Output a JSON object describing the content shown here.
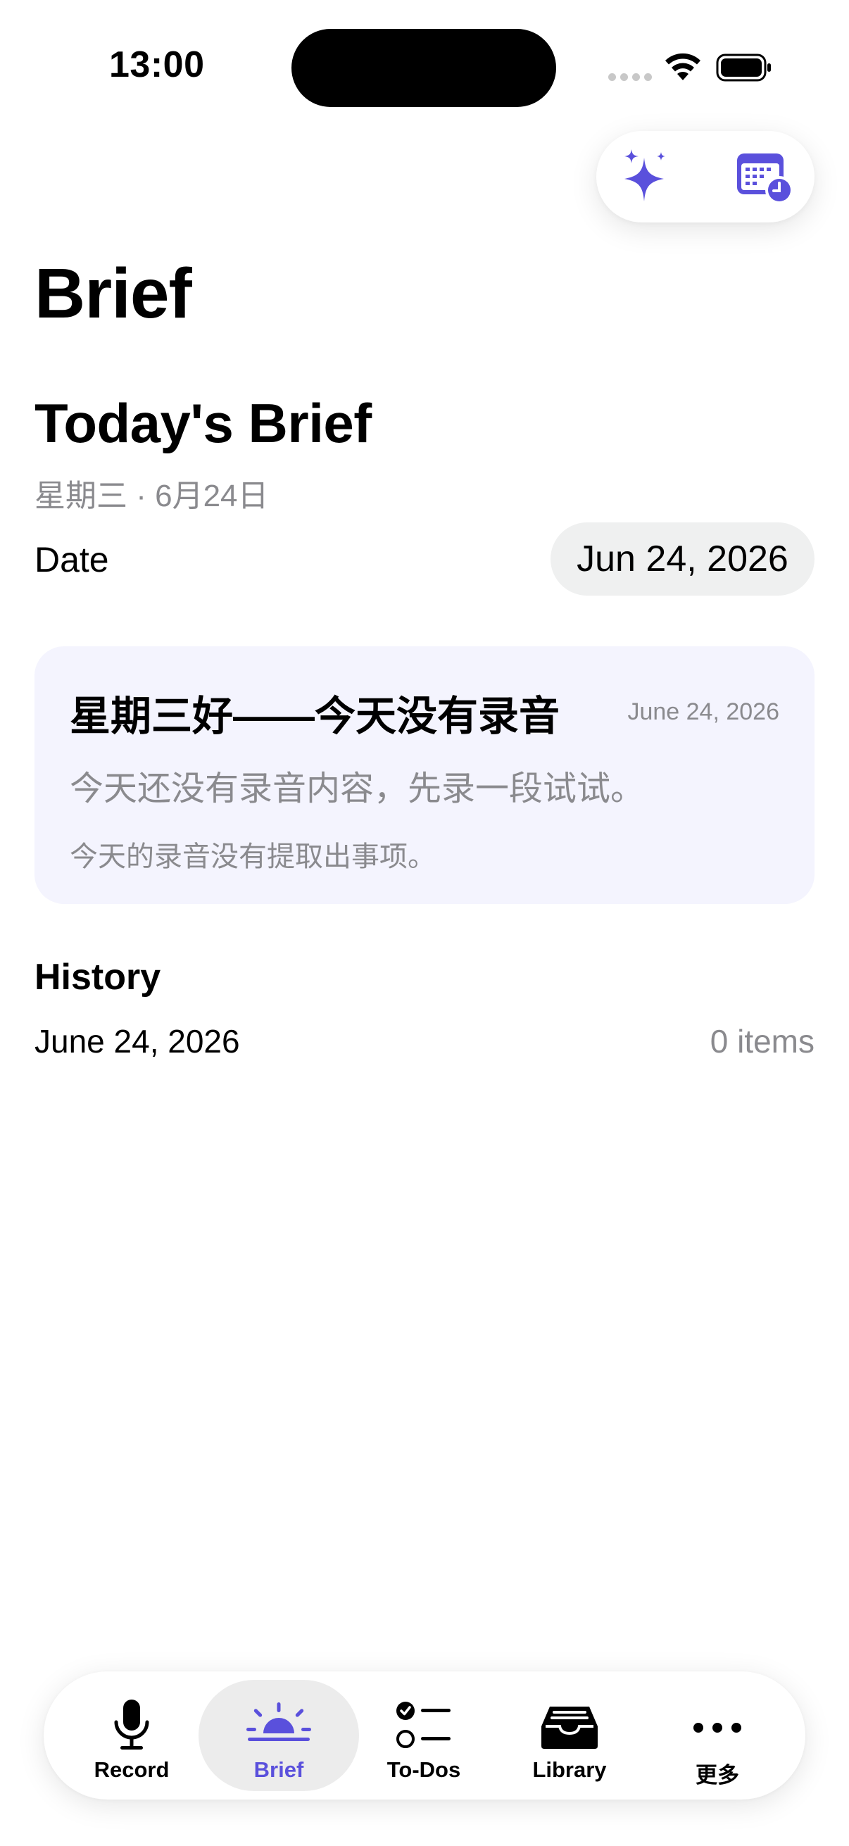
{
  "status_bar": {
    "time": "13:00"
  },
  "colors": {
    "accent": "#5a50dc",
    "card_bg": "#f4f4fe",
    "secondary_text": "#8a8a8e",
    "pill_bg": "#eff0f0"
  },
  "header": {
    "title": "Brief",
    "actions": [
      {
        "icon": "sparkles-icon"
      },
      {
        "icon": "calendar-clock-icon"
      }
    ]
  },
  "today": {
    "title": "Today's Brief",
    "weekday_date": "星期三 · 6月24日",
    "date_label": "Date",
    "date_value": "Jun 24, 2026"
  },
  "brief_card": {
    "headline": "星期三好——今天没有录音",
    "date": "June 24, 2026",
    "summary": "今天还没有录音内容，先录一段试试。",
    "note": "今天的录音没有提取出事项。"
  },
  "history": {
    "title": "History",
    "items": [
      {
        "date": "June 24, 2026",
        "count": "0 items"
      }
    ]
  },
  "tab_bar": {
    "tabs": [
      {
        "label": "Record",
        "icon": "microphone-icon",
        "active": false
      },
      {
        "label": "Brief",
        "icon": "sunrise-icon",
        "active": true
      },
      {
        "label": "To-Dos",
        "icon": "checklist-icon",
        "active": false
      },
      {
        "label": "Library",
        "icon": "tray-icon",
        "active": false
      },
      {
        "label": "更多",
        "icon": "more-icon",
        "active": false
      }
    ]
  }
}
